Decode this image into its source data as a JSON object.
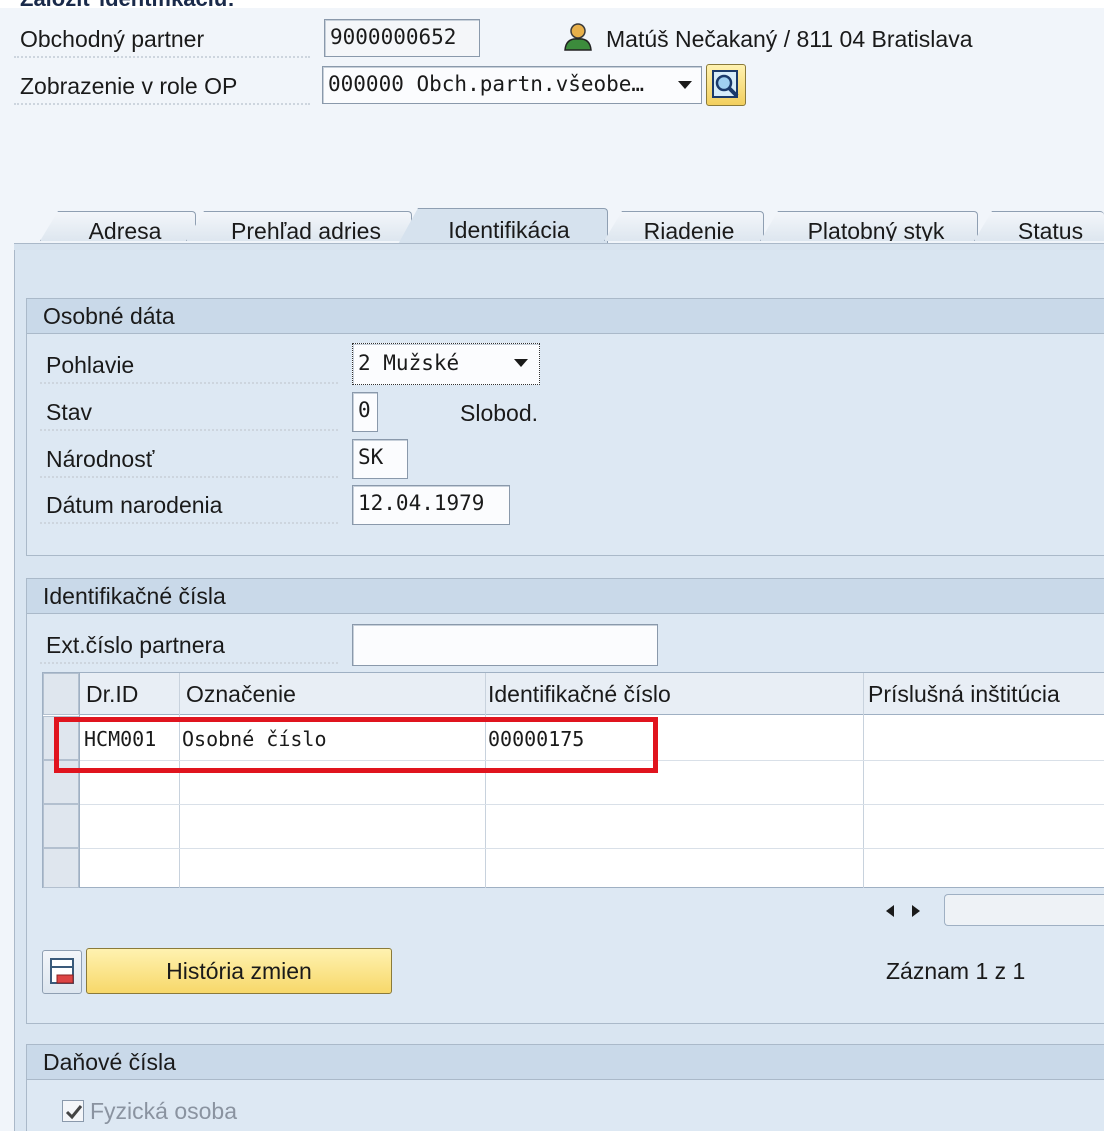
{
  "page_heading_cut": "Založiť identifikáciu:",
  "header": {
    "partner_label": "Obchodný partner",
    "partner_value": "9000000652",
    "partner_desc": "Matúš Nečakaný / 811 04 Bratislava",
    "role_label": "Zobrazenie v role OP",
    "role_value": "000000 Obch.partn.všeobe…"
  },
  "tabs": [
    {
      "label": "Adresa",
      "active": false
    },
    {
      "label": "Prehľad adries",
      "active": false
    },
    {
      "label": "Identifikácia",
      "active": true
    },
    {
      "label": "Riadenie",
      "active": false
    },
    {
      "label": "Platobný styk",
      "active": false
    },
    {
      "label": "Status",
      "active": false
    }
  ],
  "personal": {
    "title": "Osobné dáta",
    "gender_label": "Pohlavie",
    "gender_value": "2 Mužské",
    "status_label": "Stav",
    "status_value": "0",
    "status_text": "Slobod.",
    "nationality_label": "Národnosť",
    "nationality_value": "SK",
    "birth_label": "Dátum narodenia",
    "birth_value": "12.04.1979"
  },
  "ids": {
    "title": "Identifikačné čísla",
    "ext_label": "Ext.číslo partnera",
    "ext_value": "",
    "columns": [
      "Dr.ID",
      "Označenie",
      "Identifikačné číslo",
      "Príslušná inštitúcia"
    ],
    "rows": [
      [
        "HCM001",
        "Osobné číslo",
        "00000175",
        ""
      ]
    ],
    "history_button": "História zmien",
    "record_text": "Záznam 1 z 1"
  },
  "tax": {
    "title": "Daňové čísla",
    "natural_person_label": "Fyzická osoba",
    "natural_person_checked": true
  }
}
